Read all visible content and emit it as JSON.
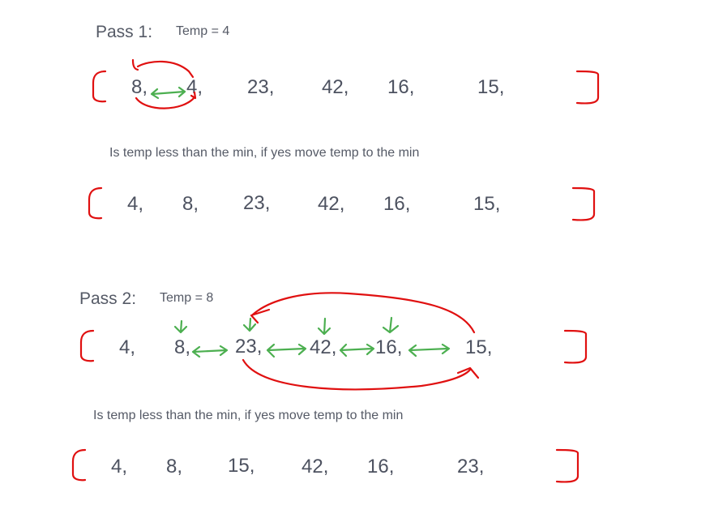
{
  "pass1": {
    "label": "Pass 1:",
    "temp": "Temp = 4",
    "before": [
      "8,",
      "4,",
      "23,",
      "42,",
      "16,",
      "15,"
    ],
    "note": "Is temp less than the min, if yes move temp to the min",
    "after": [
      "4,",
      "8,",
      "23,",
      "42,",
      "16,",
      "15,"
    ]
  },
  "pass2": {
    "label": "Pass 2:",
    "temp": "Temp = 8",
    "before": [
      "4,",
      "8,",
      "23,",
      "42,",
      "16,",
      "15,"
    ],
    "note": "Is temp less than the min, if yes move temp to the min",
    "after": [
      "4,",
      "8,",
      "15,",
      "42,",
      "16,",
      "23,"
    ]
  },
  "colors": {
    "bracket": "#e01010",
    "swap_arrow": "#4caf50",
    "text": "#4d5260"
  }
}
